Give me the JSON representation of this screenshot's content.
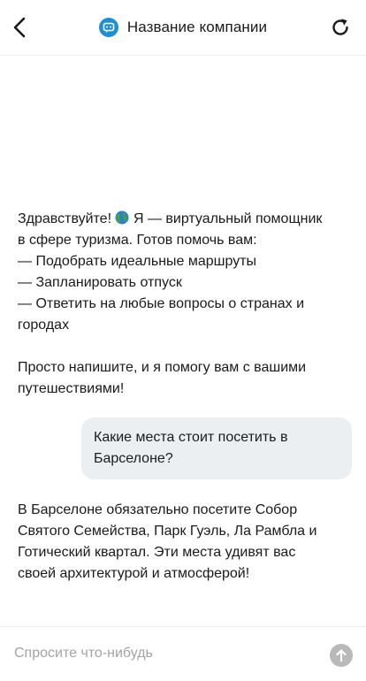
{
  "header": {
    "title": "Название компании",
    "back_icon": "chevron-left-icon",
    "logo_icon": "chat-bot-icon",
    "refresh_icon": "refresh-icon",
    "brand_color": "#1d8fd8"
  },
  "messages": {
    "greeting": {
      "line1_before_icon": "Здравствуйте!",
      "icon": "globe-icon",
      "line1_after_icon": "Я — виртуальный помощник",
      "line2": "в сфере туризма. Готов помочь вам:",
      "line3": "— Подобрать идеальные маршруты",
      "line4": "— Запланировать отпуск",
      "line5": "— Ответить на любые вопросы о странах и",
      "line6": "городах",
      "line7": "Просто напишите, и я помогу вам с вашими",
      "line8": "путешествиями!"
    },
    "user_question": {
      "line1": "Какие места стоит посетить в",
      "line2": "Барселоне?"
    },
    "bot_answer": {
      "line1": "В Барселоне обязательно посетите Собор",
      "line2": "Святого Семейства, Парк Гуэль, Ла Рамбла и",
      "line3": "Готический квартал. Эти места удивят вас",
      "line4": "своей архитектурой и атмосферой!"
    }
  },
  "composer": {
    "placeholder": "Спросите что-нибудь",
    "value": "",
    "send_icon": "arrow-up-icon",
    "send_color": "#b9b9b9"
  }
}
